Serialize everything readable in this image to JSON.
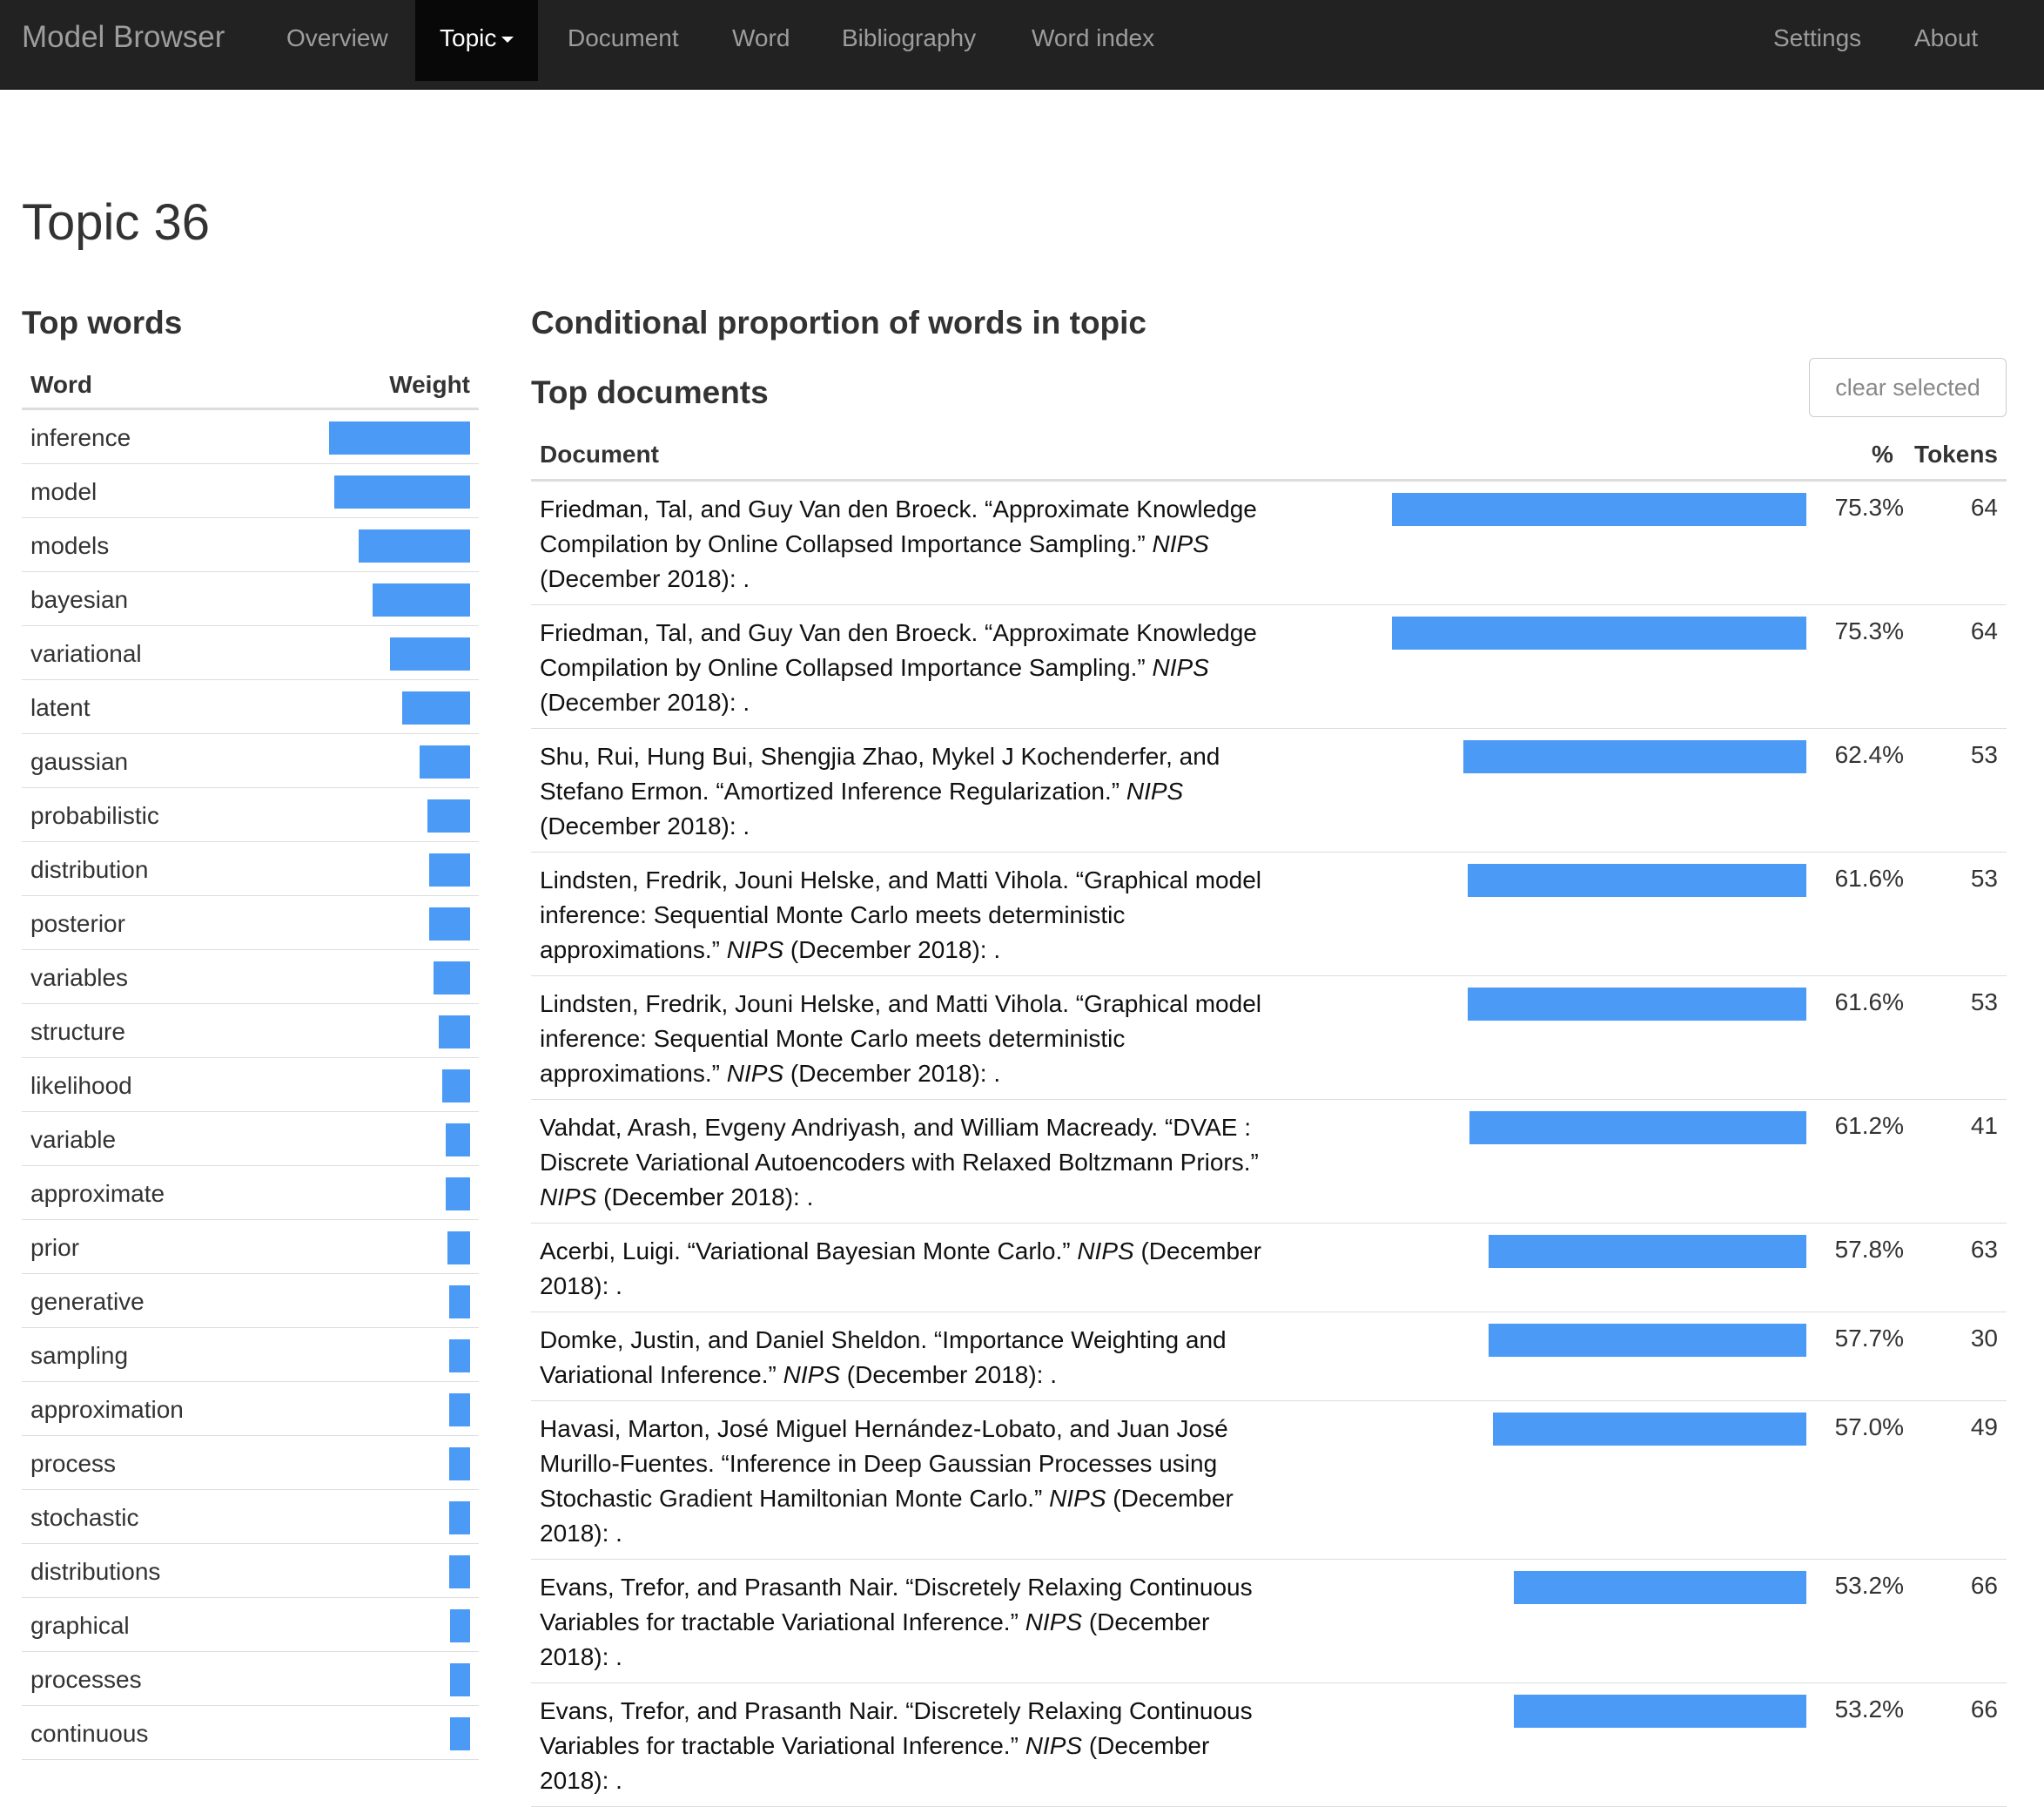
{
  "navbar": {
    "brand": "Model Browser",
    "items": [
      {
        "label": "Overview"
      },
      {
        "label": "Topic"
      },
      {
        "label": "Document"
      },
      {
        "label": "Word"
      },
      {
        "label": "Bibliography"
      },
      {
        "label": "Word index"
      },
      {
        "label": "Settings"
      },
      {
        "label": "About"
      }
    ],
    "active": "Topic"
  },
  "page": {
    "title": "Topic 36",
    "top_words_heading": "Top words",
    "conditional_heading": "Conditional proportion of words in topic",
    "top_documents_heading": "Top documents",
    "clear_button": "clear selected"
  },
  "words_table": {
    "col_word": "Word",
    "col_weight": "Weight",
    "rows": [
      {
        "word": "inference",
        "weight": 1.0
      },
      {
        "word": "model",
        "weight": 0.96
      },
      {
        "word": "models",
        "weight": 0.79
      },
      {
        "word": "bayesian",
        "weight": 0.69
      },
      {
        "word": "variational",
        "weight": 0.57
      },
      {
        "word": "latent",
        "weight": 0.48
      },
      {
        "word": "gaussian",
        "weight": 0.36
      },
      {
        "word": "probabilistic",
        "weight": 0.3
      },
      {
        "word": "distribution",
        "weight": 0.29
      },
      {
        "word": "posterior",
        "weight": 0.29
      },
      {
        "word": "variables",
        "weight": 0.26
      },
      {
        "word": "structure",
        "weight": 0.22
      },
      {
        "word": "likelihood",
        "weight": 0.2
      },
      {
        "word": "variable",
        "weight": 0.17
      },
      {
        "word": "approximate",
        "weight": 0.17
      },
      {
        "word": "prior",
        "weight": 0.16
      },
      {
        "word": "generative",
        "weight": 0.15
      },
      {
        "word": "sampling",
        "weight": 0.15
      },
      {
        "word": "approximation",
        "weight": 0.15
      },
      {
        "word": "process",
        "weight": 0.15
      },
      {
        "word": "stochastic",
        "weight": 0.15
      },
      {
        "word": "distributions",
        "weight": 0.15
      },
      {
        "word": "graphical",
        "weight": 0.14
      },
      {
        "word": "processes",
        "weight": 0.14
      },
      {
        "word": "continuous",
        "weight": 0.14
      }
    ]
  },
  "docs_table": {
    "col_document": "Document",
    "col_pct": "%",
    "col_tokens": "Tokens",
    "rows": [
      {
        "before": "Friedman, Tal, and Guy Van den Broeck. “Approximate Knowledge Compilation by Online Collapsed Importance Sampling.” ",
        "journal": "NIPS",
        "after": " (December 2018): .",
        "pct_label": "75.3%",
        "pct": 75.3,
        "tokens": "64",
        "lines": 3
      },
      {
        "before": "Friedman, Tal, and Guy Van den Broeck. “Approximate Knowledge Compilation by Online Collapsed Importance Sampling.” ",
        "journal": "NIPS",
        "after": " (December 2018): .",
        "pct_label": "75.3%",
        "pct": 75.3,
        "tokens": "64",
        "lines": 3
      },
      {
        "before": "Shu, Rui, Hung Bui, Shengjia Zhao, Mykel J Kochenderfer, and Stefano Ermon. “Amortized Inference Regularization.” ",
        "journal": "NIPS",
        "after": " (December 2018): .",
        "pct_label": "62.4%",
        "pct": 62.4,
        "tokens": "53",
        "lines": 3
      },
      {
        "before": "Lindsten, Fredrik, Jouni Helske, and Matti Vihola. “Graphical model inference: Sequential Monte Carlo meets deterministic approximations.” ",
        "journal": "NIPS",
        "after": " (December 2018): .",
        "pct_label": "61.6%",
        "pct": 61.6,
        "tokens": "53",
        "lines": 3
      },
      {
        "before": "Lindsten, Fredrik, Jouni Helske, and Matti Vihola. “Graphical model inference: Sequential Monte Carlo meets deterministic approximations.” ",
        "journal": "NIPS",
        "after": " (December 2018): .",
        "pct_label": "61.6%",
        "pct": 61.6,
        "tokens": "53",
        "lines": 3
      },
      {
        "before": "Vahdat, Arash, Evgeny Andriyash, and William Macready. “DVAE : Discrete Variational Autoencoders with Relaxed Boltzmann Priors.” ",
        "journal": "NIPS",
        "after": " (December 2018): .",
        "pct_label": "61.2%",
        "pct": 61.2,
        "tokens": "41",
        "lines": 3
      },
      {
        "before": "Acerbi, Luigi. “Variational Bayesian Monte Carlo.” ",
        "journal": "NIPS",
        "after": " (December 2018): .",
        "pct_label": "57.8%",
        "pct": 57.8,
        "tokens": "63",
        "lines": 2
      },
      {
        "before": "Domke, Justin, and Daniel Sheldon. “Importance Weighting and Variational Inference.” ",
        "journal": "NIPS",
        "after": " (December 2018): .",
        "pct_label": "57.7%",
        "pct": 57.7,
        "tokens": "30",
        "lines": 2
      },
      {
        "before": "Havasi, Marton, José Miguel Hernández-Lobato, and Juan José Murillo-Fuentes. “Inference in Deep Gaussian Processes using Stochastic Gradient Hamiltonian Monte Carlo.” ",
        "journal": "NIPS",
        "after": " (December 2018): .",
        "pct_label": "57.0%",
        "pct": 57.0,
        "tokens": "49",
        "lines": 4
      },
      {
        "before": "Evans, Trefor, and Prasanth Nair. “Discretely Relaxing Continuous Variables for tractable Variational Inference.” ",
        "journal": "NIPS",
        "after": " (December 2018): .",
        "pct_label": "53.2%",
        "pct": 53.2,
        "tokens": "66",
        "lines": 3
      },
      {
        "before": "Evans, Trefor, and Prasanth Nair. “Discretely Relaxing Continuous Variables for tractable Variational Inference.” ",
        "journal": "NIPS",
        "after": " (December 2018): .",
        "pct_label": "53.2%",
        "pct": 53.2,
        "tokens": "66",
        "lines": 3
      }
    ]
  },
  "colors": {
    "bar": "#4b9af6",
    "navbar_bg": "#222222",
    "navbar_active_bg": "#080808"
  }
}
